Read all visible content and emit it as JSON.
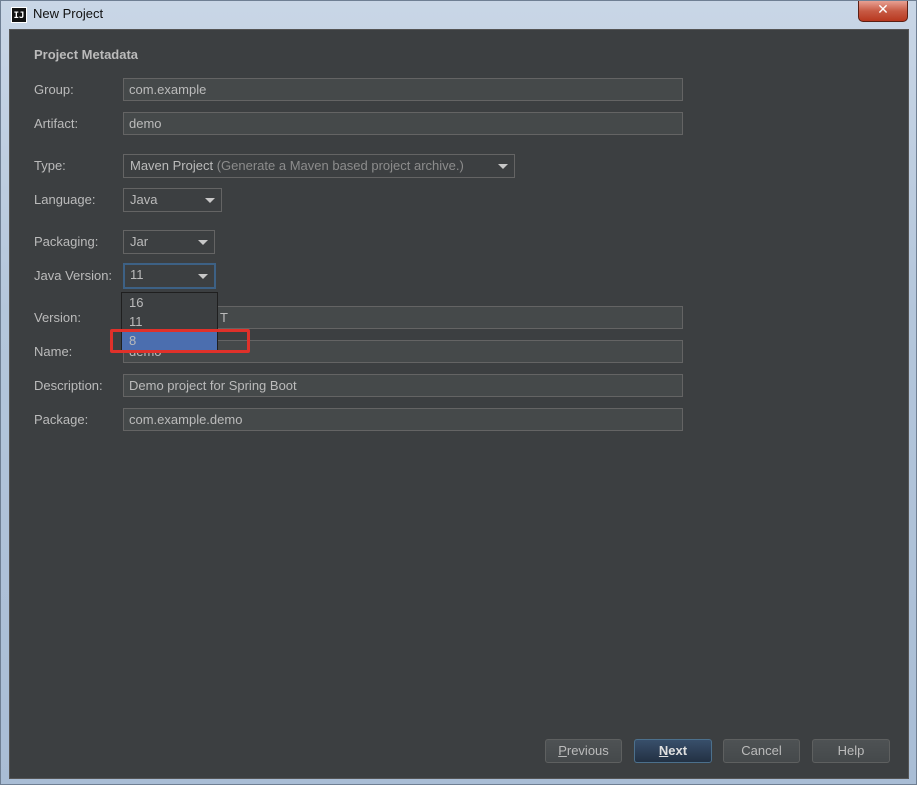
{
  "window": {
    "title": "New Project",
    "app_icon_text": "IJ",
    "close_symbol": "✕"
  },
  "section_title": "Project Metadata",
  "fields": {
    "group": {
      "label": "Group:",
      "value": "com.example"
    },
    "artifact": {
      "label": "Artifact:",
      "value": "demo"
    },
    "type": {
      "label": "Type:",
      "value": "Maven Project",
      "hint": "(Generate a Maven based project archive.)"
    },
    "language": {
      "label": "Language:",
      "value": "Java"
    },
    "packaging": {
      "label": "Packaging:",
      "value": "Jar"
    },
    "java_version": {
      "label": "Java Version:",
      "value": "11"
    },
    "version": {
      "label": "Version:",
      "value": "T"
    },
    "name": {
      "label": "Name:",
      "value": "demo"
    },
    "description": {
      "label": "Description:",
      "value": "Demo project for Spring Boot"
    },
    "package": {
      "label": "Package:",
      "value": "com.example.demo"
    }
  },
  "java_version_dropdown": {
    "options": [
      "16",
      "11",
      "8"
    ],
    "highlighted": "8"
  },
  "buttons": {
    "previous": {
      "mnemonic": "P",
      "rest": "revious"
    },
    "next": {
      "mnemonic": "N",
      "rest": "ext"
    },
    "cancel": "Cancel",
    "help": "Help"
  },
  "colors": {
    "dialog_bg": "#3c3f41",
    "selection": "#4b6eaf",
    "annotation_red": "#e0312a",
    "primary_button": "#2c3e55"
  }
}
